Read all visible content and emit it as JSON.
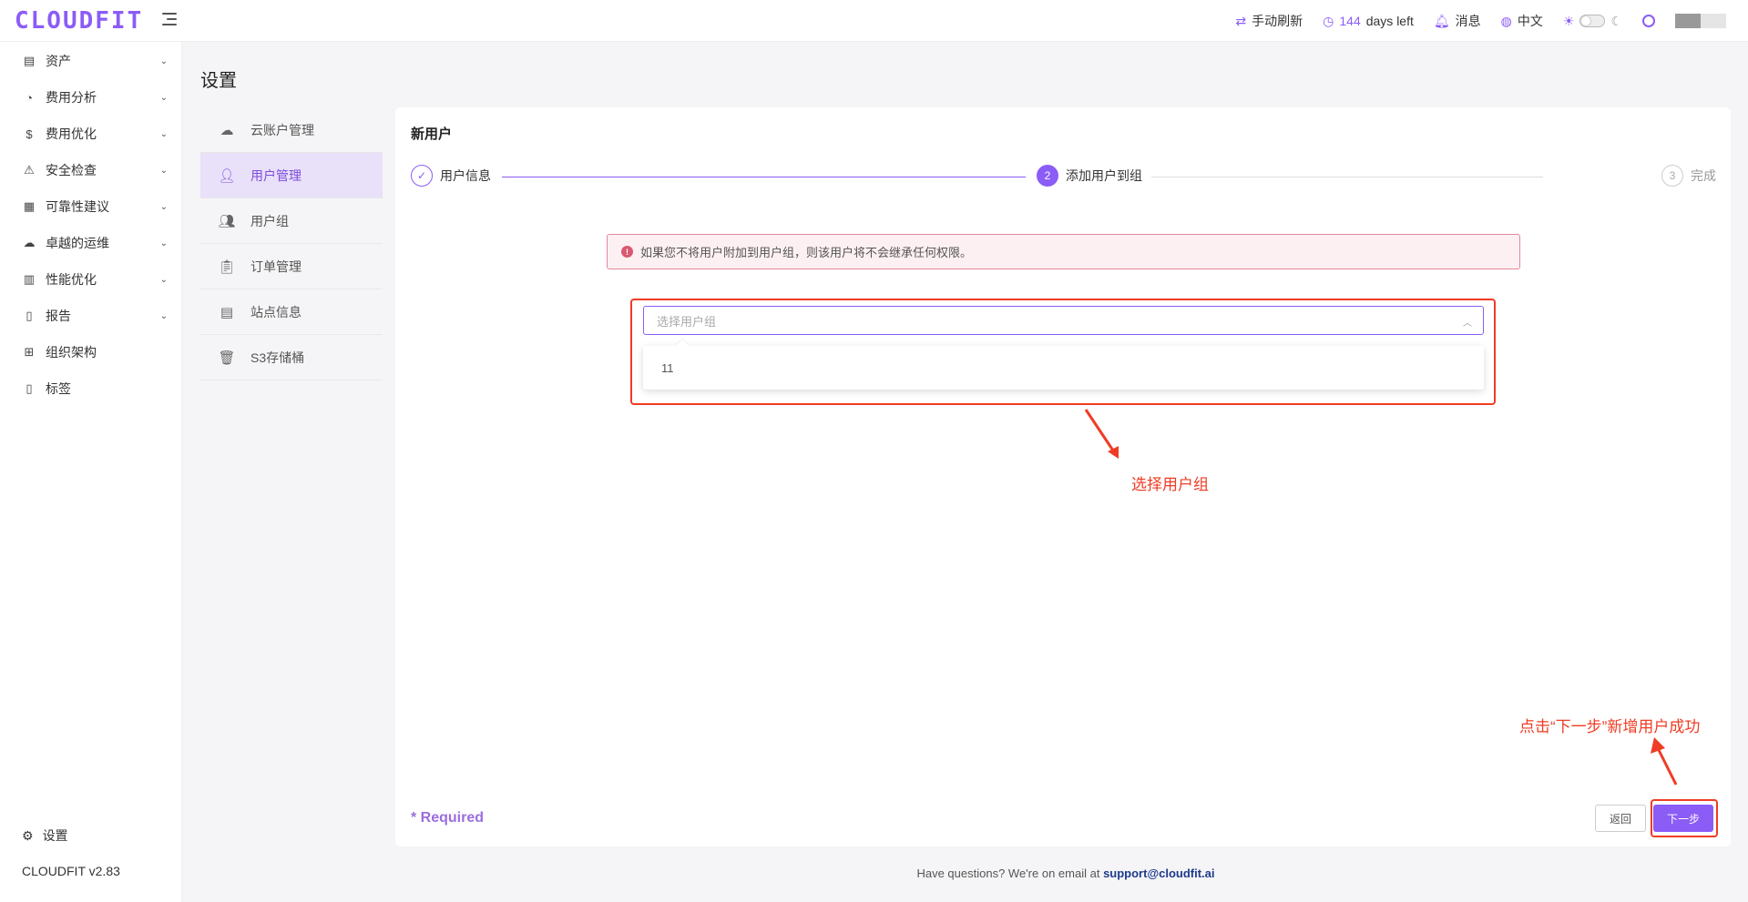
{
  "header": {
    "logo": "CLOUDFIT",
    "refresh_label": "手动刷新",
    "days_num": "144",
    "days_suffix": "days left",
    "messages_label": "消息",
    "language_label": "中文"
  },
  "sidebar": {
    "items": [
      {
        "label": "资产",
        "icon": "asset-icon"
      },
      {
        "label": "费用分析",
        "icon": "gauge-icon"
      },
      {
        "label": "费用优化",
        "icon": "dollar-icon"
      },
      {
        "label": "安全检查",
        "icon": "alarm-icon"
      },
      {
        "label": "可靠性建议",
        "icon": "report-icon"
      },
      {
        "label": "卓越的运维",
        "icon": "cloud-gear-icon"
      },
      {
        "label": "性能优化",
        "icon": "chart-icon"
      },
      {
        "label": "报告",
        "icon": "document-icon"
      },
      {
        "label": "组织架构",
        "icon": "org-icon"
      },
      {
        "label": "标签",
        "icon": "tag-icon"
      }
    ],
    "settings_label": "设置",
    "version": "CLOUDFIT v2.83"
  },
  "page": {
    "title": "设置"
  },
  "submenu": {
    "items": [
      {
        "label": "云账户管理",
        "icon": "cloud-icon"
      },
      {
        "label": "用户管理",
        "icon": "user-icon"
      },
      {
        "label": "用户组",
        "icon": "users-icon"
      },
      {
        "label": "订单管理",
        "icon": "clipboard-icon"
      },
      {
        "label": "站点信息",
        "icon": "site-icon"
      },
      {
        "label": "S3存储桶",
        "icon": "bucket-icon"
      }
    ]
  },
  "card": {
    "title": "新用户",
    "steps": [
      {
        "label": "用户信息",
        "marker": "✓"
      },
      {
        "label": "添加用户到组",
        "marker": "2"
      },
      {
        "label": "完成",
        "marker": "3"
      }
    ],
    "alert": "如果您不将用户附加到用户组，则该用户将不会继承任何权限。",
    "select_placeholder": "选择用户组",
    "options": [
      "11"
    ],
    "required_label": "* Required",
    "back_label": "返回",
    "next_label": "下一步"
  },
  "annotations": {
    "select_hint": "选择用户组",
    "next_hint": "点击“下一步”新增用户成功"
  },
  "footer": {
    "text": "Have questions? We're on email at",
    "email": "support@cloudfit.ai"
  },
  "colors": {
    "accent": "#8b5cf6",
    "annotation": "#f03c24",
    "alert_border": "#e08a9a"
  }
}
